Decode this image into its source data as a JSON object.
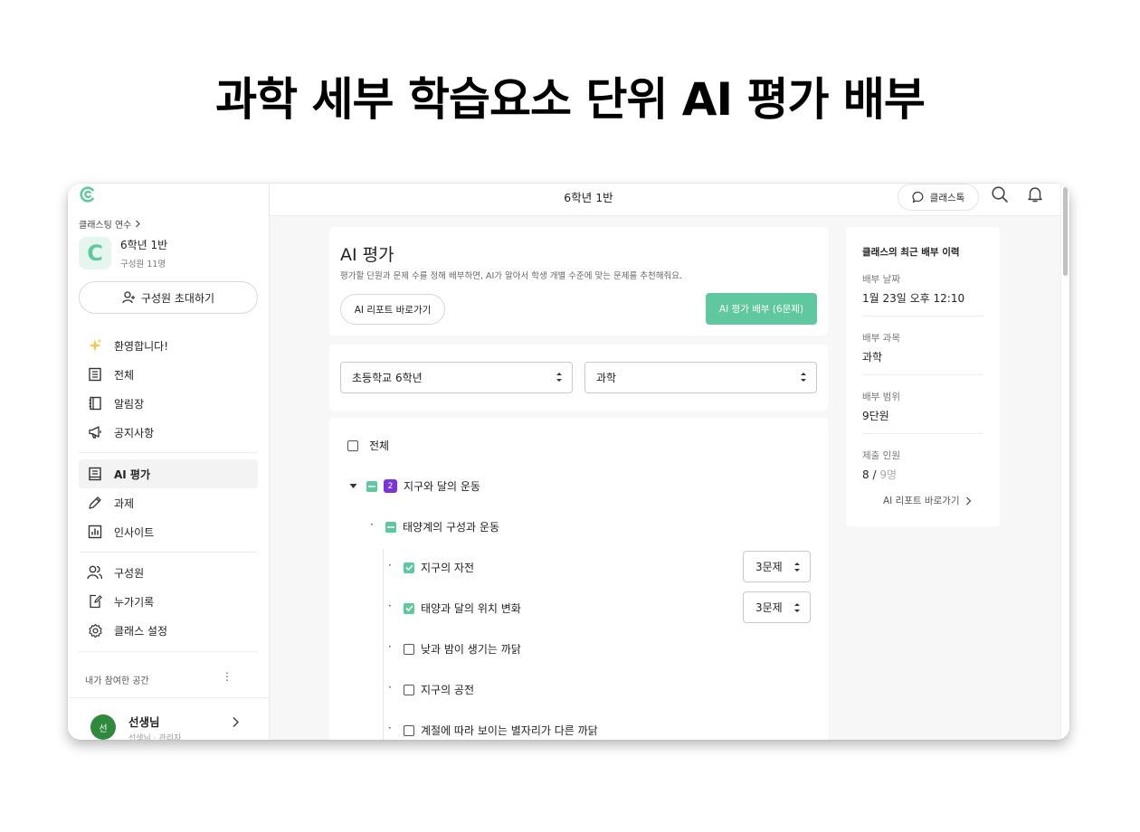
{
  "hero": {
    "title": "과학 세부 학습요소 단위 AI 평가 배부"
  },
  "sidebar": {
    "breadcrumb": "클래스팅 연수",
    "class_initial": "C",
    "class_name": "6학년 1반",
    "class_members": "구성원 11명",
    "invite_label": "구성원 초대하기",
    "group1": [
      {
        "label": "환영합니다!",
        "icon": "sparkle-icon"
      },
      {
        "label": "전체",
        "icon": "list-icon"
      },
      {
        "label": "알림장",
        "icon": "notebook-icon"
      },
      {
        "label": "공지사항",
        "icon": "megaphone-icon"
      }
    ],
    "group2": [
      {
        "label": "AI 평가",
        "icon": "ai-assessment-icon",
        "active": true
      },
      {
        "label": "과제",
        "icon": "pencil-icon"
      },
      {
        "label": "인사이트",
        "icon": "chart-icon"
      }
    ],
    "group3": [
      {
        "label": "구성원",
        "icon": "members-icon"
      },
      {
        "label": "누가기록",
        "icon": "record-icon"
      },
      {
        "label": "클래스 설정",
        "icon": "gear-icon"
      }
    ],
    "spaces_label": "내가 참여한 공간",
    "user": {
      "avatar_text": "선",
      "name": "선생님",
      "role": "선생님 · 관리자"
    }
  },
  "topbar": {
    "title": "6학년 1반",
    "chat_label": "클래스톡"
  },
  "header": {
    "title": "AI 평가",
    "description": "평가할 단원과 문제 수를 정해 배부하면, AI가 알아서 학생 개별 수준에 맞는 문제를 추천해줘요.",
    "report_button": "AI 리포트 바로가기",
    "deploy_button": "AI 평가 배부 (6문제)"
  },
  "filters": {
    "grade": "초등학교 6학년",
    "subject": "과학"
  },
  "tree": {
    "all_label": "전체",
    "unit_badge": "2",
    "unit_label": "지구와 달의 운동",
    "subunit_label": "태양계의 구성과 운동",
    "elements": [
      {
        "label": "지구의 자전",
        "checked": true,
        "quantity": "3문제"
      },
      {
        "label": "태양과 달의 위치 변화",
        "checked": true,
        "quantity": "3문제"
      },
      {
        "label": "낮과 밤이 생기는 까닭",
        "checked": false,
        "quantity": ""
      },
      {
        "label": "지구의 공전",
        "checked": false,
        "quantity": ""
      },
      {
        "label": "계절에 따라 보이는 별자리가 다른 까닭",
        "checked": false,
        "quantity": ""
      }
    ]
  },
  "history": {
    "title": "클래스의 최근 배부 이력",
    "date_label": "배부 날짜",
    "date_value": "1월 23일 오후 12:10",
    "subject_label": "배부 과목",
    "subject_value": "과학",
    "range_label": "배부 범위",
    "range_value": "9단원",
    "submit_label": "제출 인원",
    "submit_count": "8",
    "submit_separator": " / ",
    "submit_total": "9명",
    "report_link": "AI 리포트 바로가기"
  },
  "colors": {
    "accent": "#5fc89e",
    "badge": "#7b35d6",
    "avatar": "#2e8b3e"
  }
}
